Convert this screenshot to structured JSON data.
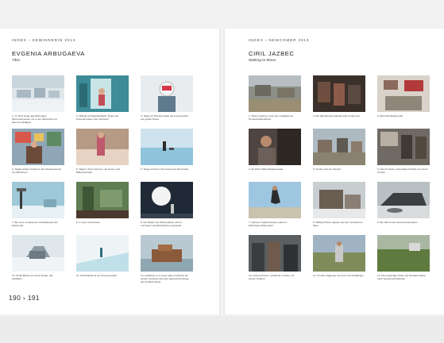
{
  "spread": {
    "left": {
      "section": "INDEX › GEWINNERIN 2013",
      "artist": "EVGENIA ARBUGAEVA",
      "series": "Tiksi",
      "page_numbers": "190 › 191",
      "photos": [
        {
          "caption": "1. Im Tiksi steigt das Wohnhaus Menschenwesen nur in der Winterzeit mit allen Feuchtigkeit",
          "icon": "photo-snowy-village"
        },
        {
          "caption": "2. Wände am Weinlandsebt, Tanja und Freunde haben sich versteckt",
          "icon": "photo-blue-curtain"
        },
        {
          "caption": "3. Tanja mit Schneemaske als Kosmonautin auf großer Reise",
          "icon": "photo-girl-mask"
        },
        {
          "caption": "4. Tanjas großer Antrieb in der Abenteuerwelt am Mittelmeer",
          "icon": "photo-colorful-room"
        },
        {
          "caption": "5. Tanja in ihrem Zimmer mit einem rosa Ballerina-Kleid",
          "icon": "photo-girl-bed"
        },
        {
          "caption": "6. Tanja mit ihrem Hund auf einer Eisscholle",
          "icon": "photo-ice-sea"
        },
        {
          "caption": "7. Bei einer verlassenen Gebäudepark als Eiswunder",
          "icon": "photo-tower-ice"
        },
        {
          "caption": "8. In einer Grasebene",
          "icon": "photo-green-hall"
        },
        {
          "caption": "9. Der Ballon der Wetterstation wird in normalem Landschaftsraum gestartet",
          "icon": "photo-balloon"
        },
        {
          "caption": "10. Schiff Maria von Gerrit Rangt, den Gefährtin",
          "icon": "photo-ice-hut"
        },
        {
          "caption": "11. Schiff Maria ist ein Hund gemacht",
          "icon": "photo-frozen-shore"
        },
        {
          "caption": "12. Gefährten von einem alten Lockboot für seinen Versteck, darunter gebrauchte Dinge der Kindheit Seule",
          "icon": "photo-rusty-boat"
        }
      ]
    },
    "right": {
      "section": "INDEX › NEWCOMER 2013",
      "artist": "CIRIL JAZBEC",
      "series": "Waiting to Move",
      "photos": [
        {
          "caption": "1. Pelery Kaamut, einer der verbliebenen Hundeschlittenführer",
          "icon": "photo-village-dogs"
        },
        {
          "caption": "2. Die Mantanuksa-Familie sitzt zusammen",
          "icon": "photo-family-room"
        },
        {
          "caption": "3. Beim Bezahlautomat",
          "icon": "photo-interior-wall"
        },
        {
          "caption": "4. Ex-Pilot Clifford Mapuussapa",
          "icon": "photo-old-man"
        },
        {
          "caption": "5. Kinder sind am Fenster",
          "icon": "photo-village-houses"
        },
        {
          "caption": "6. Dennis Stock, ehemaliger Polizist mit seiner Tochter",
          "icon": "photo-kitchen"
        },
        {
          "caption": "7. Hansee Traditionsweise spielt im Wohnhaus Rollenspiel",
          "icon": "photo-jumping-man"
        },
        {
          "caption": "8. Milking Wörter spielen auf dem Gefrorenen Meer",
          "icon": "photo-shed-snow"
        },
        {
          "caption": "9. Ein Wal ist der Gefrorensuchtraum",
          "icon": "photo-seal-boat"
        },
        {
          "caption": "10. Vincent Peters, schlafend in Ohrer mit seinen Kindern",
          "icon": "photo-men-group"
        },
        {
          "caption": "11. Timothy Nagoyak und John mit Schafkögel",
          "icon": "photo-girl-field"
        },
        {
          "caption": "12. Die Lebendige Küste mit Friedhof Sheila nach Gemeinschaftsraum",
          "icon": "photo-green-tundra"
        }
      ]
    }
  }
}
